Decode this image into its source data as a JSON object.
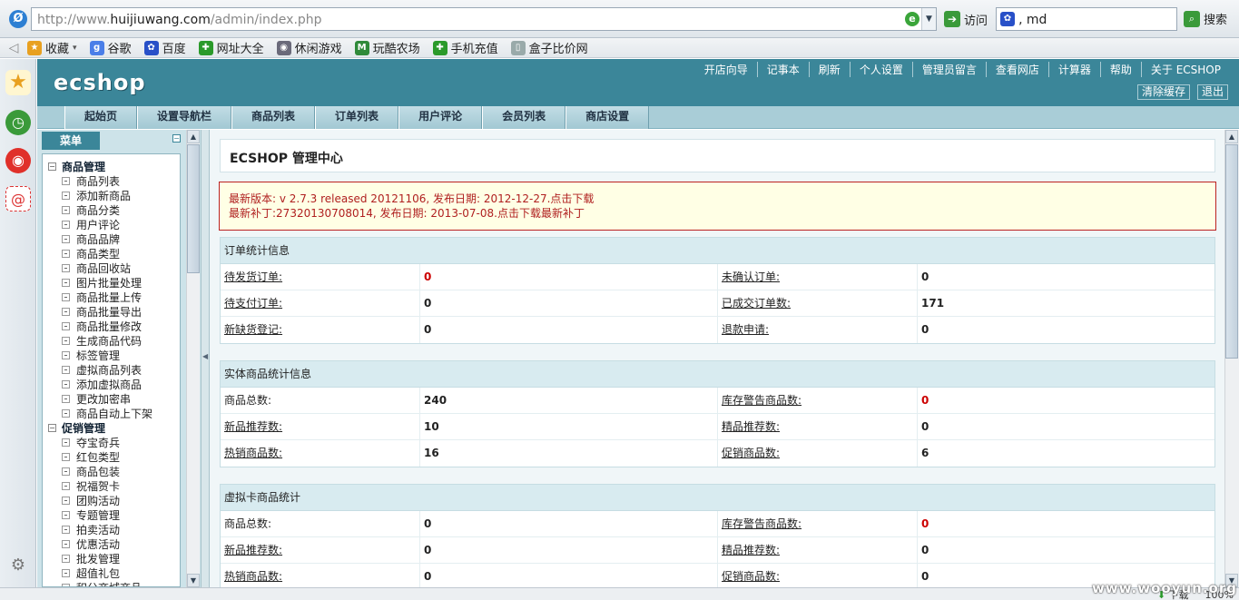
{
  "browser": {
    "url_prefix": "http://www.",
    "url_host": "huijiuwang.com",
    "url_path": "/admin/index.php",
    "go_label": "访问",
    "search_value": "‚ md",
    "search_label": "搜索"
  },
  "favorites": [
    {
      "label": "收藏",
      "icon": "star-icon",
      "color": "#e8a020",
      "glyph": "★"
    },
    {
      "label": "谷歌",
      "icon": "google-icon",
      "color": "#4a7ee8",
      "glyph": "g"
    },
    {
      "label": "百度",
      "icon": "baidu-paw-icon",
      "color": "#2850c8",
      "glyph": "✿"
    },
    {
      "label": "网址大全",
      "icon": "web-directory-icon",
      "color": "#2a9a2a",
      "glyph": "✚"
    },
    {
      "label": "休闲游戏",
      "icon": "gamepad-icon",
      "color": "#6a6a7a",
      "glyph": "◉"
    },
    {
      "label": "玩酷农场",
      "icon": "farm-game-icon",
      "color": "#2f8a3a",
      "glyph": "M"
    },
    {
      "label": "手机充值",
      "icon": "mobile-recharge-icon",
      "color": "#2a9a2a",
      "glyph": "✚"
    },
    {
      "label": "盒子比价网",
      "icon": "page-icon",
      "color": "#9aa",
      "glyph": "▯"
    }
  ],
  "header": {
    "logo": "ecshop",
    "top_links": [
      "开店向导",
      "记事本",
      "刷新",
      "个人设置",
      "管理员留言",
      "查看网店",
      "计算器",
      "帮助",
      "关于 ECSHOP"
    ],
    "clear_cache": "清除缓存",
    "logout": "退出"
  },
  "main_menu": [
    "起始页",
    "设置导航栏",
    "商品列表",
    "订单列表",
    "用户评论",
    "会员列表",
    "商店设置"
  ],
  "side_menu": {
    "tab_label": "菜单",
    "groups": [
      {
        "label": "商品管理",
        "items": [
          "商品列表",
          "添加新商品",
          "商品分类",
          "用户评论",
          "商品品牌",
          "商品类型",
          "商品回收站",
          "图片批量处理",
          "商品批量上传",
          "商品批量导出",
          "商品批量修改",
          "生成商品代码",
          "标签管理",
          "虚拟商品列表",
          "添加虚拟商品",
          "更改加密串",
          "商品自动上下架"
        ]
      },
      {
        "label": "促销管理",
        "items": [
          "夺宝奇兵",
          "红包类型",
          "商品包装",
          "祝福贺卡",
          "团购活动",
          "专题管理",
          "拍卖活动",
          "优惠活动",
          "批发管理",
          "超值礼包",
          "积分商城商品"
        ]
      }
    ]
  },
  "content": {
    "title": "ECSHOP 管理中心",
    "notice_line1": "最新版本: v 2.7.3 released 20121106, 发布日期: 2012-12-27.点击下载",
    "notice_line2": "最新补丁:27320130708014, 发布日期: 2013-07-08.点击下载最新补丁",
    "order_stats": {
      "heading": "订单统计信息",
      "rows": [
        {
          "l1": "待发货订单:",
          "v1": "0",
          "v1_red": true,
          "l2": "未确认订单:",
          "v2": "0",
          "v2_red": false
        },
        {
          "l1": "待支付订单:",
          "v1": "0",
          "v1_red": false,
          "l2": "已成交订单数:",
          "v2": "171",
          "v2_red": false
        },
        {
          "l1": "新缺货登记:",
          "v1": "0",
          "v1_red": false,
          "l2": "退款申请:",
          "v2": "0",
          "v2_red": false
        }
      ]
    },
    "goods_stats": {
      "heading": "实体商品统计信息",
      "rows": [
        {
          "l1": "商品总数:",
          "v1": "240",
          "v1_red": false,
          "l2": "库存警告商品数:",
          "v2": "0",
          "v2_red": true
        },
        {
          "l1": "新品推荐数:",
          "v1": "10",
          "v1_red": false,
          "l2": "精品推荐数:",
          "v2": "0",
          "v2_red": false
        },
        {
          "l1": "热销商品数:",
          "v1": "16",
          "v1_red": false,
          "l2": "促销商品数:",
          "v2": "6",
          "v2_red": false
        }
      ]
    },
    "virtual_stats": {
      "heading": "虚拟卡商品统计",
      "rows": [
        {
          "l1": "商品总数:",
          "v1": "0",
          "v1_red": false,
          "l2": "库存警告商品数:",
          "v2": "0",
          "v2_red": true
        },
        {
          "l1": "新品推荐数:",
          "v1": "0",
          "v1_red": false,
          "l2": "精品推荐数:",
          "v2": "0",
          "v2_red": false
        },
        {
          "l1": "热销商品数:",
          "v1": "0",
          "v1_red": false,
          "l2": "促销商品数:",
          "v2": "0",
          "v2_red": false
        }
      ]
    }
  },
  "status_bar": {
    "download": "下载",
    "zoom": "100%"
  },
  "watermark": "www.wooyun.org"
}
